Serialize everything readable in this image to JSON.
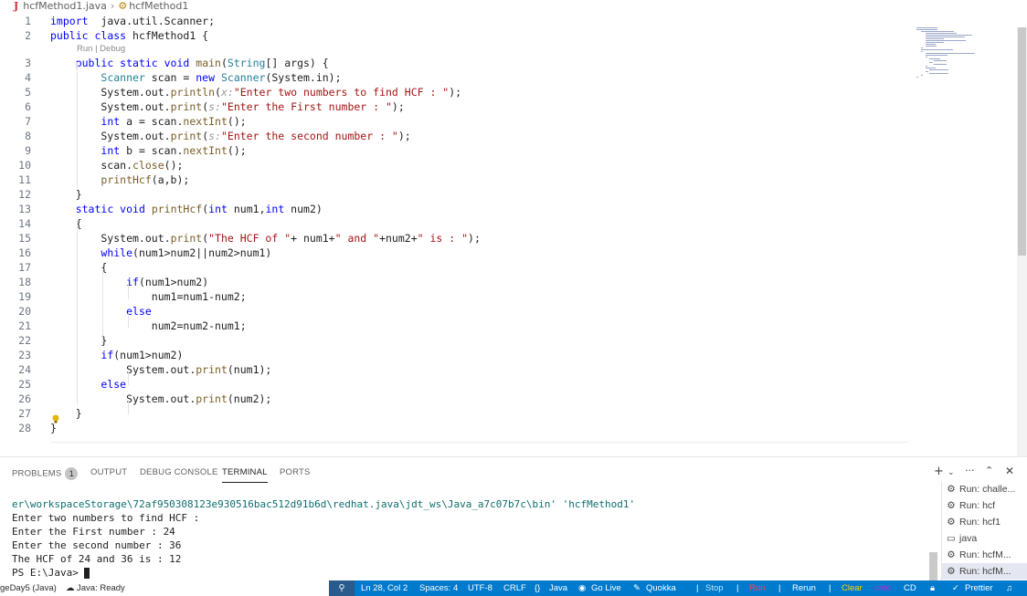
{
  "breadcrumb": {
    "file": "hcfMethod1.java",
    "symbol": "hcfMethod1",
    "file_icon": "J"
  },
  "editor": {
    "codelens": "Run | Debug",
    "lines": [
      {
        "n": "1",
        "segs": [
          [
            "kw",
            "import"
          ],
          [
            "",
            "  java.util.Scanner;"
          ]
        ]
      },
      {
        "n": "2",
        "segs": [
          [
            "kw",
            "public"
          ],
          [
            "",
            ""
          ],
          [
            "kw",
            " class"
          ],
          [
            "",
            " hcfMethod1 {"
          ]
        ]
      },
      {
        "n": "3",
        "segs": [
          [
            "",
            "    "
          ],
          [
            "kw",
            "public static void"
          ],
          [
            "",
            " "
          ],
          [
            "fn",
            "main"
          ],
          [
            "",
            "("
          ],
          [
            "type",
            "String"
          ],
          [
            "",
            "[] args) {"
          ]
        ]
      },
      {
        "n": "4",
        "segs": [
          [
            "",
            "        "
          ],
          [
            "type",
            "Scanner"
          ],
          [
            "",
            " scan = "
          ],
          [
            "kw",
            "new"
          ],
          [
            "",
            " "
          ],
          [
            "type",
            "Scanner"
          ],
          [
            "",
            "(System.in);"
          ]
        ]
      },
      {
        "n": "5",
        "segs": [
          [
            "",
            "        System.out."
          ],
          [
            "fn",
            "println"
          ],
          [
            "",
            "("
          ],
          [
            "hint",
            "x:"
          ],
          [
            "str",
            "\"Enter two numbers to find HCF : \""
          ],
          [
            "",
            ");"
          ]
        ]
      },
      {
        "n": "6",
        "segs": [
          [
            "",
            "        System.out."
          ],
          [
            "fn",
            "print"
          ],
          [
            "",
            "("
          ],
          [
            "hint",
            "s:"
          ],
          [
            "str",
            "\"Enter the First number : \""
          ],
          [
            "",
            ");"
          ]
        ]
      },
      {
        "n": "7",
        "segs": [
          [
            "",
            "        "
          ],
          [
            "kw",
            "int"
          ],
          [
            "",
            " a = scan."
          ],
          [
            "fn",
            "nextInt"
          ],
          [
            "",
            "();"
          ]
        ]
      },
      {
        "n": "8",
        "segs": [
          [
            "",
            "        System.out."
          ],
          [
            "fn",
            "print"
          ],
          [
            "",
            "("
          ],
          [
            "hint",
            "s:"
          ],
          [
            "str",
            "\"Enter the second number : \""
          ],
          [
            "",
            ");"
          ]
        ]
      },
      {
        "n": "9",
        "segs": [
          [
            "",
            "        "
          ],
          [
            "kw",
            "int"
          ],
          [
            "",
            " b = scan."
          ],
          [
            "fn",
            "nextInt"
          ],
          [
            "",
            "();"
          ]
        ]
      },
      {
        "n": "10",
        "segs": [
          [
            "",
            "        scan."
          ],
          [
            "fn",
            "close"
          ],
          [
            "",
            "();"
          ]
        ]
      },
      {
        "n": "11",
        "segs": [
          [
            "",
            "        "
          ],
          [
            "fn",
            "printHcf"
          ],
          [
            "",
            "(a,b);"
          ]
        ]
      },
      {
        "n": "12",
        "segs": [
          [
            "",
            "    }"
          ]
        ]
      },
      {
        "n": "13",
        "segs": [
          [
            "",
            "    "
          ],
          [
            "kw",
            "static void"
          ],
          [
            "",
            " "
          ],
          [
            "fn",
            "printHcf"
          ],
          [
            "",
            "("
          ],
          [
            "kw",
            "int"
          ],
          [
            "",
            " num1,"
          ],
          [
            "kw",
            "int"
          ],
          [
            "",
            " num2)"
          ]
        ]
      },
      {
        "n": "14",
        "segs": [
          [
            "",
            "    {"
          ]
        ]
      },
      {
        "n": "15",
        "segs": [
          [
            "",
            "        System.out."
          ],
          [
            "fn",
            "print"
          ],
          [
            "",
            "("
          ],
          [
            "str",
            "\"The HCF of \""
          ],
          [
            "",
            "+ num1+"
          ],
          [
            "str",
            "\" and \""
          ],
          [
            "",
            "+num2+"
          ],
          [
            "str",
            "\" is : \""
          ],
          [
            "",
            ");"
          ]
        ]
      },
      {
        "n": "16",
        "segs": [
          [
            "",
            "        "
          ],
          [
            "kw",
            "while"
          ],
          [
            "",
            "(num1>num2||num2>num1)"
          ]
        ]
      },
      {
        "n": "17",
        "segs": [
          [
            "",
            "        {"
          ]
        ]
      },
      {
        "n": "18",
        "segs": [
          [
            "",
            "            "
          ],
          [
            "kw",
            "if"
          ],
          [
            "",
            "(num1>num2)"
          ]
        ]
      },
      {
        "n": "19",
        "segs": [
          [
            "",
            "                num1=num1-num2;"
          ]
        ]
      },
      {
        "n": "20",
        "segs": [
          [
            "",
            "            "
          ],
          [
            "kw",
            "else"
          ]
        ]
      },
      {
        "n": "21",
        "segs": [
          [
            "",
            "                num2=num2-num1;"
          ]
        ]
      },
      {
        "n": "22",
        "segs": [
          [
            "",
            "        }"
          ]
        ]
      },
      {
        "n": "23",
        "segs": [
          [
            "",
            "        "
          ],
          [
            "kw",
            "if"
          ],
          [
            "",
            "(num1>num2)"
          ]
        ]
      },
      {
        "n": "24",
        "segs": [
          [
            "",
            "            System.out."
          ],
          [
            "fn",
            "print"
          ],
          [
            "",
            "(num1);"
          ]
        ]
      },
      {
        "n": "25",
        "segs": [
          [
            "",
            "        "
          ],
          [
            "kw",
            "else"
          ]
        ]
      },
      {
        "n": "26",
        "segs": [
          [
            "",
            "            System.out."
          ],
          [
            "fn",
            "print"
          ],
          [
            "",
            "(num2);"
          ]
        ]
      },
      {
        "n": "27",
        "segs": [
          [
            "",
            "    }"
          ]
        ]
      },
      {
        "n": "28",
        "segs": [
          [
            "",
            "}"
          ]
        ]
      }
    ]
  },
  "panel": {
    "tabs": {
      "problems": "PROBLEMS",
      "problems_count": "1",
      "output": "OUTPUT",
      "debug_console": "DEBUG CONSOLE",
      "terminal": "TERMINAL",
      "ports": "PORTS"
    },
    "terminal_lines": [
      "er\\workspaceStorage\\72af950308123e930516bac512d91b6d\\redhat.java\\jdt_ws\\Java_a7c07b7c\\bin' 'hcfMethod1'",
      "Enter two numbers to find HCF :",
      "Enter the First number : 24",
      "Enter the second number : 36",
      "The HCF of 24 and 36 is : 12"
    ],
    "prompt": "PS E:\\Java> ",
    "terminal_list": [
      {
        "label": "Run: challe...",
        "icon": "debug"
      },
      {
        "label": "Run: hcf",
        "icon": "debug"
      },
      {
        "label": "Run: hcf1",
        "icon": "debug"
      },
      {
        "label": "java",
        "icon": "terminal"
      },
      {
        "label": "Run: hcfM...",
        "icon": "debug"
      },
      {
        "label": "Run: hcfM...",
        "icon": "debug"
      }
    ]
  },
  "statusbar": {
    "project": "geDay5 (Java)",
    "java_status": "Java: Ready",
    "position": "Ln 28, Col 2",
    "spaces": "Spaces: 4",
    "encoding": "UTF-8",
    "eol": "CRLF",
    "language": "Java",
    "golive": "Go Live",
    "quokka": "Quokka",
    "stop": "Stop",
    "run": "Run",
    "rerun": "Rerun",
    "clear": "Clear",
    "cmd": "cmd",
    "cd": "CD",
    "prettier": "Prettier",
    "colors": {
      "bar": "#007acc",
      "stop": "#bfe6ff",
      "run": "#f14c4c",
      "clear": "#ffd700",
      "cmd": "#d11fd1"
    }
  }
}
